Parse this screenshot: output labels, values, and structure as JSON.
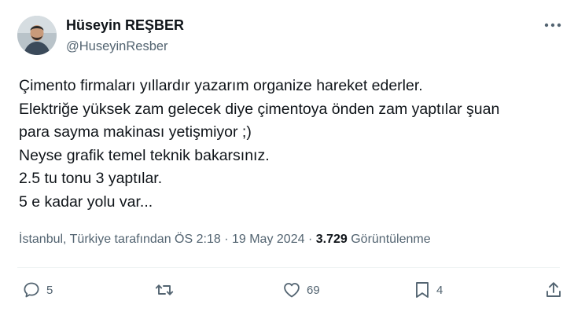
{
  "author": {
    "display_name": "Hüseyin REŞBER",
    "handle": "@HuseyinResber"
  },
  "tweet": {
    "lines": [
      "Çimento firmaları yıllardır yazarım organize hareket ederler.",
      "Elektriğe yüksek zam gelecek diye çimentoya önden zam yaptılar şuan",
      "para sayma makinası yetişmiyor ;)",
      "Neyse grafik temel teknik bakarsınız.",
      "2.5 tu tonu 3 yaptılar.",
      "5 e kadar yolu var..."
    ]
  },
  "meta": {
    "location": "İstanbul, Türkiye tarafından",
    "time": "ÖS 2:18",
    "separator": "·",
    "date": "19 May 2024",
    "views_count": "3.729",
    "views_label": "Görüntülenme"
  },
  "actions": {
    "reply_count": "5",
    "like_count": "69",
    "bookmark_count": "4"
  },
  "colors": {
    "text_primary": "#0f1419",
    "text_secondary": "#536471",
    "divider": "#eff3f4"
  },
  "icons": [
    "more-icon",
    "reply-icon",
    "retweet-icon",
    "like-icon",
    "bookmark-icon",
    "share-icon"
  ]
}
